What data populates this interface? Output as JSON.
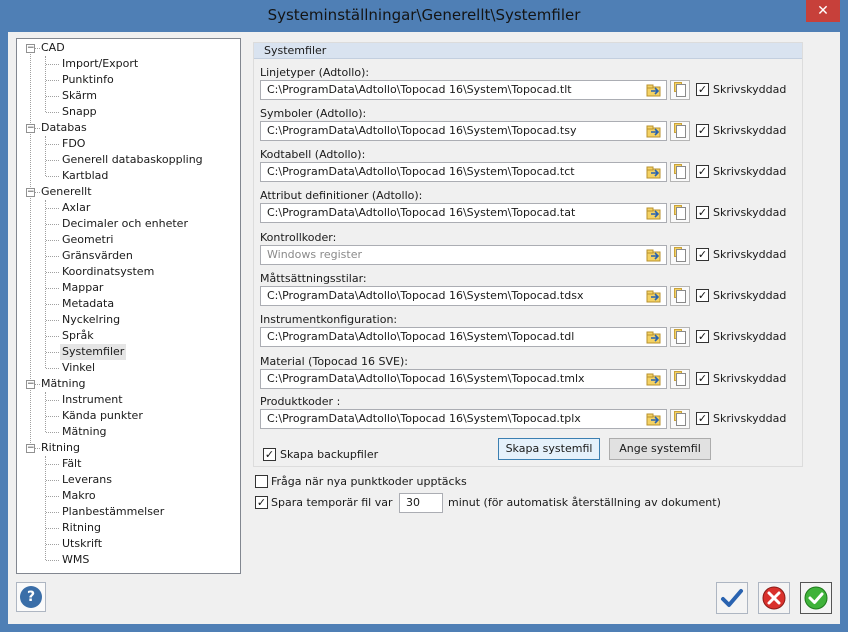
{
  "window": {
    "title": "Systeminställningar\\Generellt\\Systemfiler",
    "close_glyph": "✕"
  },
  "tree": [
    {
      "label": "CAD",
      "children": [
        "Import/Export",
        "Punktinfo",
        "Skärm",
        "Snapp"
      ]
    },
    {
      "label": "Databas",
      "children": [
        "FDO",
        "Generell databaskoppling",
        "Kartblad"
      ]
    },
    {
      "label": "Generellt",
      "children": [
        "Axlar",
        "Decimaler och enheter",
        "Geometri",
        "Gränsvärden",
        "Koordinatsystem",
        "Mappar",
        "Metadata",
        "Nyckelring",
        "Språk",
        "Systemfiler",
        "Vinkel"
      ]
    },
    {
      "label": "Mätning",
      "children": [
        "Instrument",
        "Kända punkter",
        "Mätning"
      ]
    },
    {
      "label": "Ritning",
      "children": [
        "Fält",
        "Leverans",
        "Makro",
        "Planbestämmelser",
        "Ritning",
        "Utskrift",
        "WMS"
      ]
    }
  ],
  "tree_selected": "Systemfiler",
  "systemfiler": {
    "header": "Systemfiler",
    "fields": [
      {
        "label": "Linjetyper (Adtollo):",
        "value": "C:\\ProgramData\\Adtollo\\Topocad 16\\System\\Topocad.tlt",
        "disabled": false,
        "checked": true
      },
      {
        "label": "Symboler (Adtollo):",
        "value": "C:\\ProgramData\\Adtollo\\Topocad 16\\System\\Topocad.tsy",
        "disabled": false,
        "checked": true
      },
      {
        "label": "Kodtabell (Adtollo):",
        "value": "C:\\ProgramData\\Adtollo\\Topocad 16\\System\\Topocad.tct",
        "disabled": false,
        "checked": true
      },
      {
        "label": "Attribut definitioner (Adtollo):",
        "value": "C:\\ProgramData\\Adtollo\\Topocad 16\\System\\Topocad.tat",
        "disabled": false,
        "checked": true
      },
      {
        "label": "Kontrollkoder:",
        "value": "Windows register",
        "disabled": true,
        "checked": true
      },
      {
        "label": "Måttsättningsstilar:",
        "value": "C:\\ProgramData\\Adtollo\\Topocad 16\\System\\Topocad.tdsx",
        "disabled": false,
        "checked": true
      },
      {
        "label": "Instrumentkonfiguration:",
        "value": "C:\\ProgramData\\Adtollo\\Topocad 16\\System\\Topocad.tdl",
        "disabled": false,
        "checked": true
      },
      {
        "label": "Material (Topocad 16 SVE):",
        "value": "C:\\ProgramData\\Adtollo\\Topocad 16\\System\\Topocad.tmlx",
        "disabled": false,
        "checked": true
      },
      {
        "label": "Produktkoder :",
        "value": "C:\\ProgramData\\Adtollo\\Topocad 16\\System\\Topocad.tplx",
        "disabled": false,
        "checked": true
      }
    ],
    "readonly_label": "Skrivskyddad",
    "backup_label": "Skapa backupfiler",
    "backup_checked": true,
    "create_button": "Skapa systemfil",
    "specify_button": "Ange systemfil"
  },
  "options": {
    "ask_label": "Fråga när nya punktkoder upptäcks",
    "ask_checked": false,
    "save_temp_label": "Spara temporär fil var",
    "save_temp_checked": true,
    "save_temp_value": "30",
    "save_temp_suffix": "minut (för automatisk återställning av dokument)"
  },
  "footer": {
    "help_glyph": "?"
  },
  "check_glyph": "✓"
}
